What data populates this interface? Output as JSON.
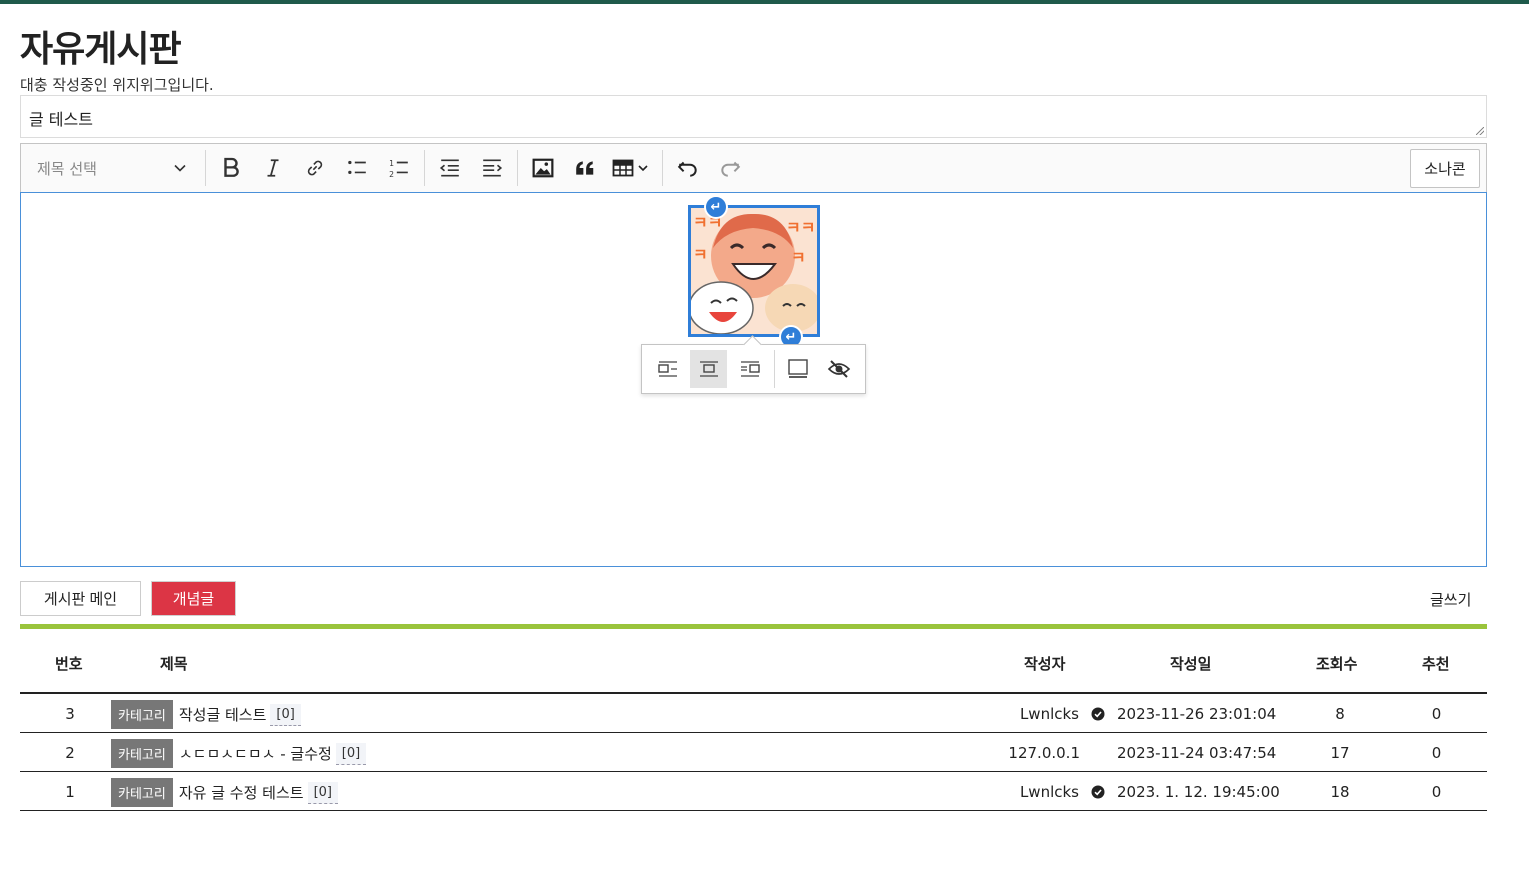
{
  "page": {
    "title": "자유게시판",
    "description": "대충 작성중인 위지위그입니다."
  },
  "form": {
    "title_value": "글 테스트"
  },
  "toolbar": {
    "heading_placeholder": "제목 선택",
    "sonakon_label": "소나콘"
  },
  "actions": {
    "board_main_label": "게시판 메인",
    "concept_label": "개념글",
    "write_label": "글쓰기"
  },
  "table": {
    "headers": {
      "num": "번호",
      "title": "제목",
      "author": "작성자",
      "date": "작성일",
      "views": "조회수",
      "recommend": "추천"
    },
    "rows": [
      {
        "num": "3",
        "category": "카테고리",
        "title": "작성글 테스트",
        "comments": "[0]",
        "author": "Lwnlcks",
        "verified": true,
        "date": "2023-11-26 23:01:04",
        "views": "8",
        "recommend": "0"
      },
      {
        "num": "2",
        "category": "카테고리",
        "title": "ㅅㄷㅁㅅㄷㅁㅅ - 글수정",
        "comments": "[0]",
        "author": "127.0.0.1",
        "verified": false,
        "date": "2023-11-24 03:47:54",
        "views": "17",
        "recommend": "0"
      },
      {
        "num": "1",
        "category": "카테고리",
        "title": "자유 글 수정 테스트",
        "comments": "[0]",
        "author": "Lwnlcks",
        "verified": true,
        "date": "2023. 1. 12. 19:45:00",
        "views": "18",
        "recommend": "0"
      }
    ]
  },
  "colors": {
    "top_bar": "#1f5a4b",
    "accent_green": "#9ac43c",
    "concept_red": "#dc3545",
    "selection_blue": "#2f7ed8"
  }
}
